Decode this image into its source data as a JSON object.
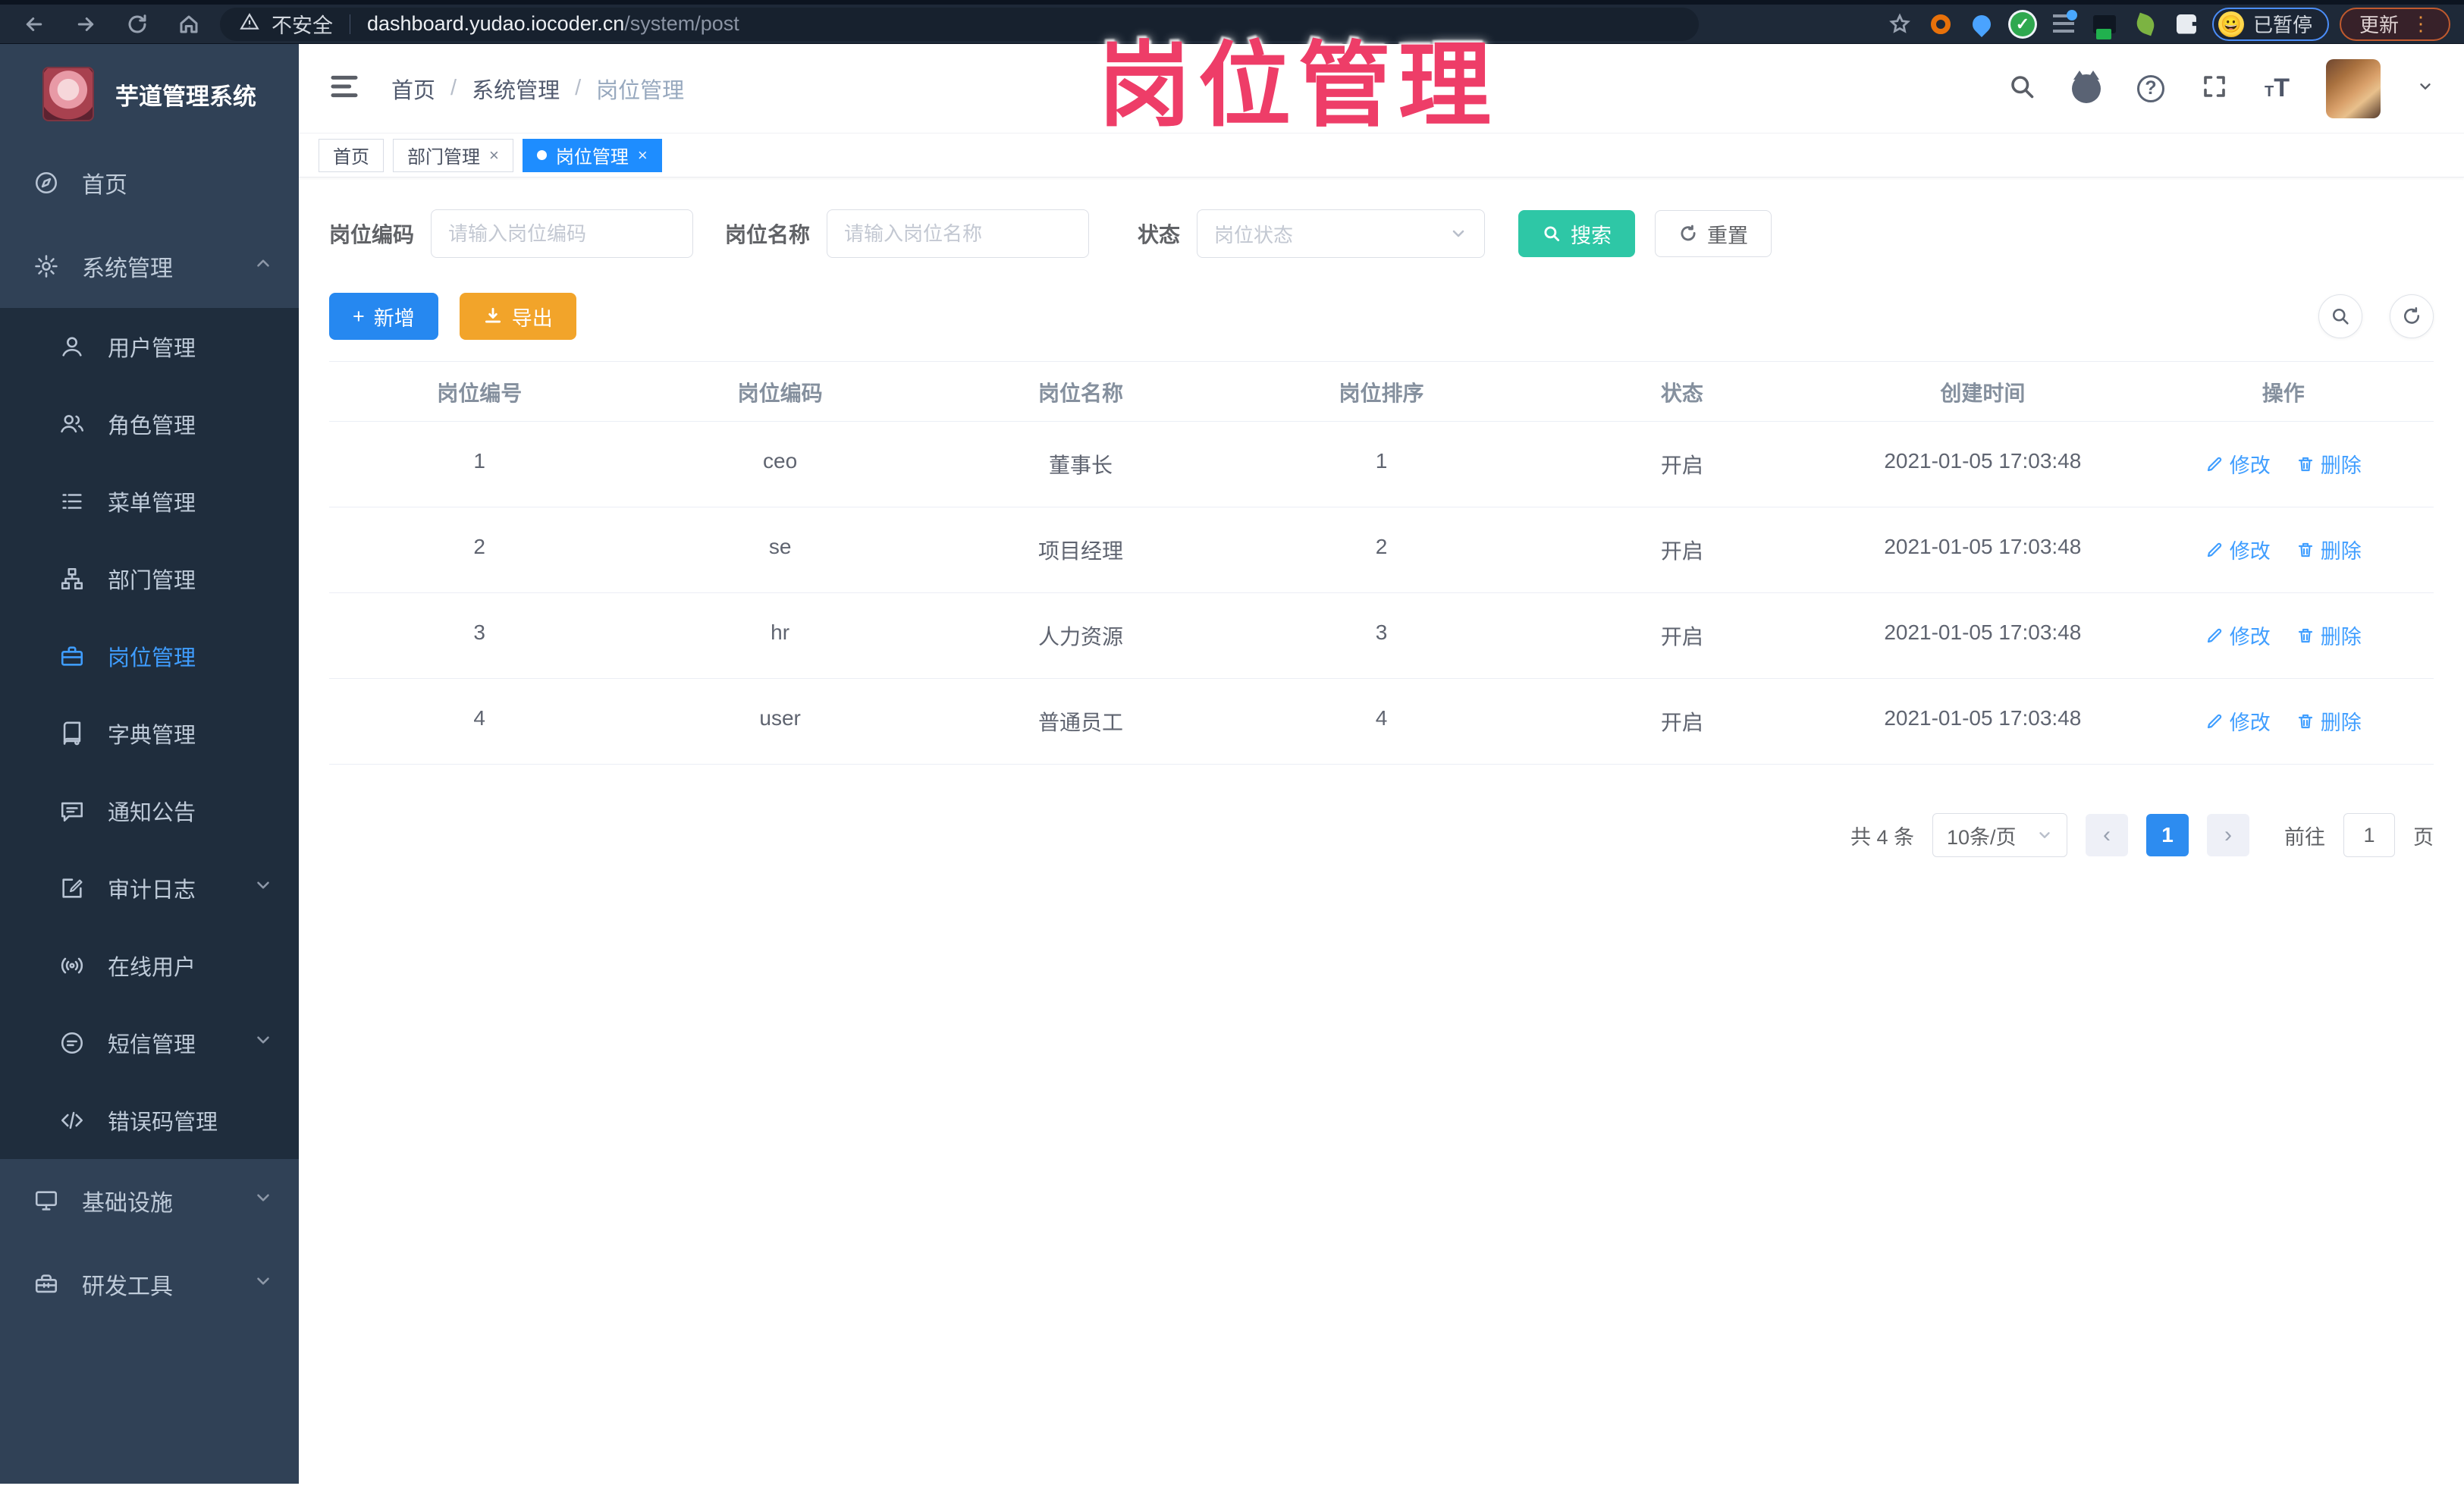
{
  "browser": {
    "security_label": "不安全",
    "url_host": "dashboard.yudao.iocoder.cn",
    "url_path": "/system/post",
    "profile_emoji": "😀",
    "profile_label": "已暂停",
    "update_label": "更新",
    "kebab": "⋮"
  },
  "watermark": "岗位管理",
  "sidebar": {
    "logo_title": "芋道管理系统",
    "items": [
      {
        "label": "首页"
      },
      {
        "label": "系统管理"
      },
      {
        "label": "用户管理"
      },
      {
        "label": "角色管理"
      },
      {
        "label": "菜单管理"
      },
      {
        "label": "部门管理"
      },
      {
        "label": "岗位管理"
      },
      {
        "label": "字典管理"
      },
      {
        "label": "通知公告"
      },
      {
        "label": "审计日志"
      },
      {
        "label": "在线用户"
      },
      {
        "label": "短信管理"
      },
      {
        "label": "错误码管理"
      },
      {
        "label": "基础设施"
      },
      {
        "label": "研发工具"
      }
    ]
  },
  "navbar": {
    "breadcrumb": [
      "首页",
      "系统管理",
      "岗位管理"
    ],
    "separator": "/"
  },
  "tabs": [
    {
      "label": "首页"
    },
    {
      "label": "部门管理",
      "close": "×"
    },
    {
      "label": "岗位管理",
      "close": "×"
    }
  ],
  "filters": {
    "code_label": "岗位编码",
    "code_placeholder": "请输入岗位编码",
    "name_label": "岗位名称",
    "name_placeholder": "请输入岗位名称",
    "status_label": "状态",
    "status_placeholder": "岗位状态",
    "search_label": "搜索",
    "reset_label": "重置"
  },
  "toolbar": {
    "add_label": "新增",
    "export_label": "导出"
  },
  "table": {
    "headers": [
      "岗位编号",
      "岗位编码",
      "岗位名称",
      "岗位排序",
      "状态",
      "创建时间",
      "操作"
    ],
    "actions": {
      "edit": "修改",
      "delete": "删除"
    },
    "rows": [
      {
        "id": "1",
        "code": "ceo",
        "name": "董事长",
        "sort": "1",
        "status": "开启",
        "created": "2021-01-05 17:03:48"
      },
      {
        "id": "2",
        "code": "se",
        "name": "项目经理",
        "sort": "2",
        "status": "开启",
        "created": "2021-01-05 17:03:48"
      },
      {
        "id": "3",
        "code": "hr",
        "name": "人力资源",
        "sort": "3",
        "status": "开启",
        "created": "2021-01-05 17:03:48"
      },
      {
        "id": "4",
        "code": "user",
        "name": "普通员工",
        "sort": "4",
        "status": "开启",
        "created": "2021-01-05 17:03:48"
      }
    ]
  },
  "pagination": {
    "total": "共 4 条",
    "page_size": "10条/页",
    "prev": "‹",
    "next": "›",
    "page": "1",
    "goto_prefix": "前往",
    "goto_value": "1",
    "goto_suffix": "页"
  },
  "colors": {
    "accent_blue": "#409eff",
    "tab_active": "#1e8dff",
    "search_teal": "#2ec7a6",
    "export_orange": "#f2a42a",
    "watermark_pink": "#ee3d68",
    "sidebar_bg": "#304156",
    "submenu_bg": "#1f2d3d"
  },
  "icons": {
    "back": "arrow-left",
    "forward": "arrow-right",
    "reload": "refresh",
    "home": "house",
    "warning": "triangle-exclamation",
    "star": "bookmark-star",
    "search": "magnifier",
    "github": "octocat",
    "help": "question-circle",
    "fullscreen": "expand",
    "font_size": "Tt",
    "edit": "pencil",
    "delete": "trash",
    "download": "arrow-into-tray",
    "plus": "+"
  }
}
